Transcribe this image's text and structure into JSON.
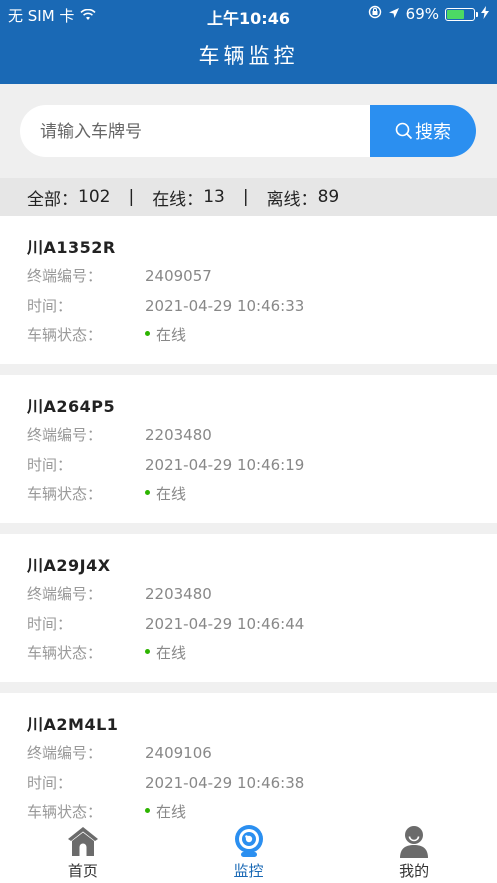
{
  "status_bar": {
    "carrier": "无 SIM 卡",
    "time": "上午10:46",
    "battery_percent": "69%",
    "battery_level": 0.69
  },
  "nav": {
    "title": "车辆监控"
  },
  "search": {
    "placeholder": "请输入车牌号",
    "button_label": "搜索"
  },
  "summary": {
    "total_label": "全部：",
    "total": "102",
    "separator": "|",
    "online_label": "在线：",
    "online": "13",
    "offline_label": "离线：",
    "offline": "89"
  },
  "field_labels": {
    "terminal_id": "终端编号：",
    "time": "时间：",
    "status": "车辆状态："
  },
  "vehicles": [
    {
      "plate": "川A1352R",
      "terminal_id": "2409057",
      "time": "2021-04-29 10:46:33",
      "status": "在线"
    },
    {
      "plate": "川A264P5",
      "terminal_id": "2203480",
      "time": "2021-04-29 10:46:19",
      "status": "在线"
    },
    {
      "plate": "川A29J4X",
      "terminal_id": "2203480",
      "time": "2021-04-29 10:46:44",
      "status": "在线"
    },
    {
      "plate": "川A2M4L1",
      "terminal_id": "2409106",
      "time": "2021-04-29 10:46:38",
      "status": "在线"
    }
  ],
  "tabs": [
    {
      "label": "首页",
      "icon": "home-icon"
    },
    {
      "label": "监控",
      "icon": "camera-icon",
      "active": true
    },
    {
      "label": "我的",
      "icon": "user-icon"
    }
  ],
  "colors": {
    "header": "#1a69b5",
    "accent": "#2b8ff0",
    "online": "#2db400"
  }
}
